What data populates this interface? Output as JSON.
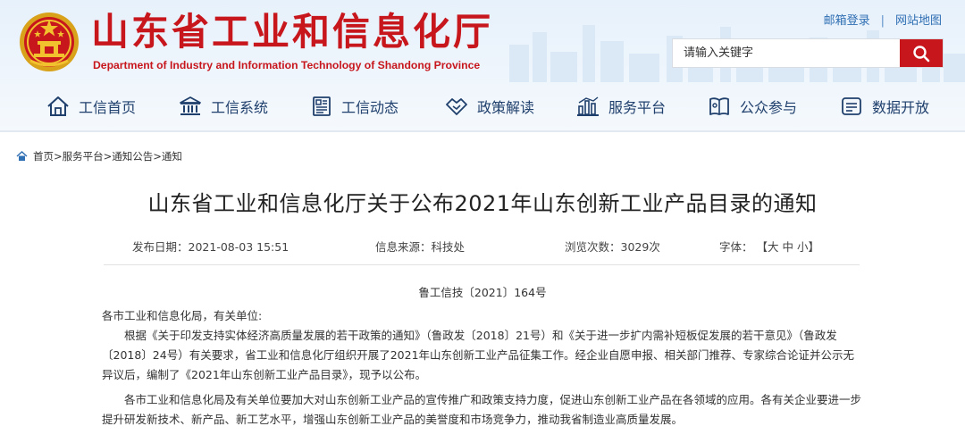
{
  "header": {
    "title": "山东省工业和信息化厅",
    "subtitle": "Department of Industry and Information Technology of Shandong Province",
    "links": {
      "mail": "邮箱登录",
      "separator": "|",
      "sitemap": "网站地图"
    },
    "search": {
      "placeholder": "请输入关键字"
    }
  },
  "nav": {
    "items": [
      {
        "label": "工信首页",
        "icon": "home-icon"
      },
      {
        "label": "工信系统",
        "icon": "institution-icon"
      },
      {
        "label": "工信动态",
        "icon": "news-icon"
      },
      {
        "label": "政策解读",
        "icon": "handshake-icon"
      },
      {
        "label": "服务平台",
        "icon": "bar-chart-icon"
      },
      {
        "label": "公众参与",
        "icon": "book-icon"
      },
      {
        "label": "数据开放",
        "icon": "monitor-icon"
      }
    ]
  },
  "breadcrumb": {
    "items": [
      "首页",
      "服务平台",
      "通知公告",
      "通知"
    ],
    "separator": ">"
  },
  "article": {
    "title": "山东省工业和信息化厅关于公布2021年山东创新工业产品目录的通知",
    "meta": {
      "date_label": "发布日期：",
      "date": "2021-08-03 15:51",
      "source_label": "信息来源：",
      "source": "科技处",
      "views_label": "浏览次数：",
      "views": "3029次",
      "font_label": "字体：",
      "font_open": "【",
      "font_large": "大",
      "font_medium": "中",
      "font_small": "小",
      "font_close": "】"
    },
    "doc_number": "鲁工信技〔2021〕164号",
    "salutation": "各市工业和信息化局，有关单位:",
    "paragraphs": [
      "根据《关于印发支持实体经济高质量发展的若干政策的通知》（鲁政发〔2018〕21号）和《关于进一步扩内需补短板促发展的若干意见》（鲁政发〔2018〕24号）有关要求，省工业和信息化厅组织开展了2021年山东创新工业产品征集工作。经企业自愿申报、相关部门推荐、专家综合论证并公示无异议后，编制了《2021年山东创新工业产品目录》，现予以公布。",
      "各市工业和信息化局及有关单位要加大对山东创新工业产品的宣传推广和政策支持力度，促进山东创新工业产品在各领域的应用。各有关企业要进一步提升研发新技术、新产品、新工艺水平，增强山东创新工业产品的美誉度和市场竞争力，推动我省制造业高质量发展。"
    ]
  },
  "colors": {
    "brand_red": "#c8161d",
    "nav_text": "#1f3f6c",
    "link_blue": "#2f6fb3"
  }
}
